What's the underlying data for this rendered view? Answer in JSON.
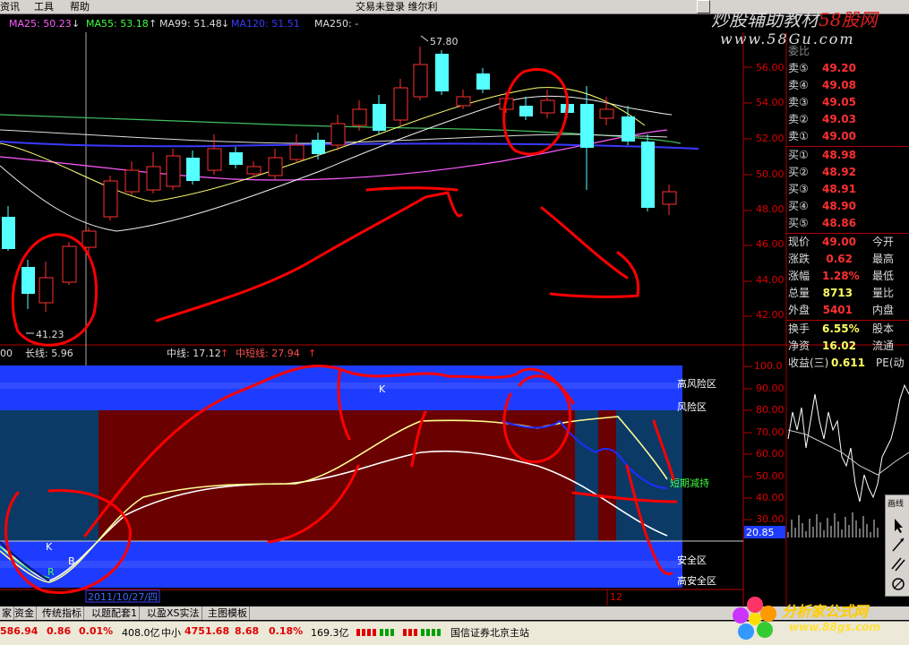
{
  "menu": {
    "items": [
      "资讯",
      "工具",
      "帮助"
    ],
    "title": "交易未登录 维尔利"
  },
  "brand_top": {
    "line1_a": "炒股辅助教材",
    "line1_b": "58股网",
    "line2": "www.58Gu.com"
  },
  "ma_bar": {
    "ma25": "MA25: 50.23",
    "ma55": "MA55: 53.18",
    "ma99": "MA99: 51.48",
    "ma120": "MA120: 51.51",
    "ma250": "MA250: -"
  },
  "price_axis": [
    "56.00",
    "54.00",
    "52.00",
    "50.00",
    "48.00",
    "46.00",
    "44.00",
    "42.00"
  ],
  "price_marks": {
    "high": "57.80",
    "low": "41.23"
  },
  "quotes": {
    "sell": [
      {
        "label": "卖⑤",
        "value": "49.20"
      },
      {
        "label": "卖④",
        "value": "49.08"
      },
      {
        "label": "卖③",
        "value": "49.05"
      },
      {
        "label": "卖②",
        "value": "49.03"
      },
      {
        "label": "卖①",
        "value": "49.00"
      }
    ],
    "buy": [
      {
        "label": "买①",
        "value": "48.98"
      },
      {
        "label": "买②",
        "value": "48.92"
      },
      {
        "label": "买③",
        "value": "48.91"
      },
      {
        "label": "买④",
        "value": "48.90"
      },
      {
        "label": "买⑤",
        "value": "48.86"
      }
    ],
    "stats": [
      {
        "label": "现价",
        "value": "49.00",
        "label2": "今开"
      },
      {
        "label": "涨跌",
        "value": "0.62",
        "label2": "最高"
      },
      {
        "label": "涨幅",
        "value": "1.28%",
        "label2": "最低"
      },
      {
        "label": "总量",
        "value": "8713",
        "label2": "量比"
      },
      {
        "label": "外盘",
        "value": "5401",
        "label2": "内盘"
      },
      {
        "label": "换手",
        "value": "6.55%",
        "label2": "股本"
      },
      {
        "label": "净资",
        "value": "16.02",
        "label2": "流通"
      },
      {
        "label": "收益(三)",
        "value": "0.611",
        "label2": "PE(动"
      }
    ],
    "header_partial": "委比"
  },
  "indicator_bar": {
    "left_value": "00",
    "long_line": "长线: 5.96",
    "mid_line": "中线: 17.12",
    "mid_long_line": "中短线: 27.94"
  },
  "indicator_axis": [
    "100.0",
    "90.00",
    "80.00",
    "70.00",
    "60.00",
    "50.00",
    "40.00",
    "30.00"
  ],
  "indicator_marker": "20.85",
  "zones": {
    "high_risk": "高风险区",
    "risk": "风险区",
    "reduce": "短期减持",
    "safe": "安全区",
    "high_safe": "高安全区"
  },
  "curve_labels": {
    "k_top": "K",
    "k_bottom": "K",
    "b": "B",
    "r": "R"
  },
  "date_axis": {
    "date": "2011/10/27/四",
    "month": "12"
  },
  "tabs": [
    "家",
    "资金",
    "传统指标",
    "以题配套1",
    "以盈XS实法",
    "主图模板"
  ],
  "status": {
    "idx1_value": "586.94",
    "idx1_change": "0.86",
    "idx1_pct": "0.01%",
    "idx1_amount": "408.0亿",
    "idx2_name": "中小",
    "idx2_value": "4751.68",
    "idx2_change": "8.68",
    "idx2_pct": "0.18%",
    "idx2_amount": "169.3亿",
    "server": "国信证券北京主站"
  },
  "tool_panel": {
    "title": "画线"
  },
  "brand_bottom": {
    "title": "分析家公式网",
    "url": "www.88gs.com"
  },
  "colors": {
    "candle_up": "#ff3030",
    "candle_down": "#54ffff",
    "zone_blue": "#1e3cff",
    "zone_darkred": "#6a0000",
    "zone_navy": "#0b3a66",
    "annotation_red": "#ff0000"
  }
}
